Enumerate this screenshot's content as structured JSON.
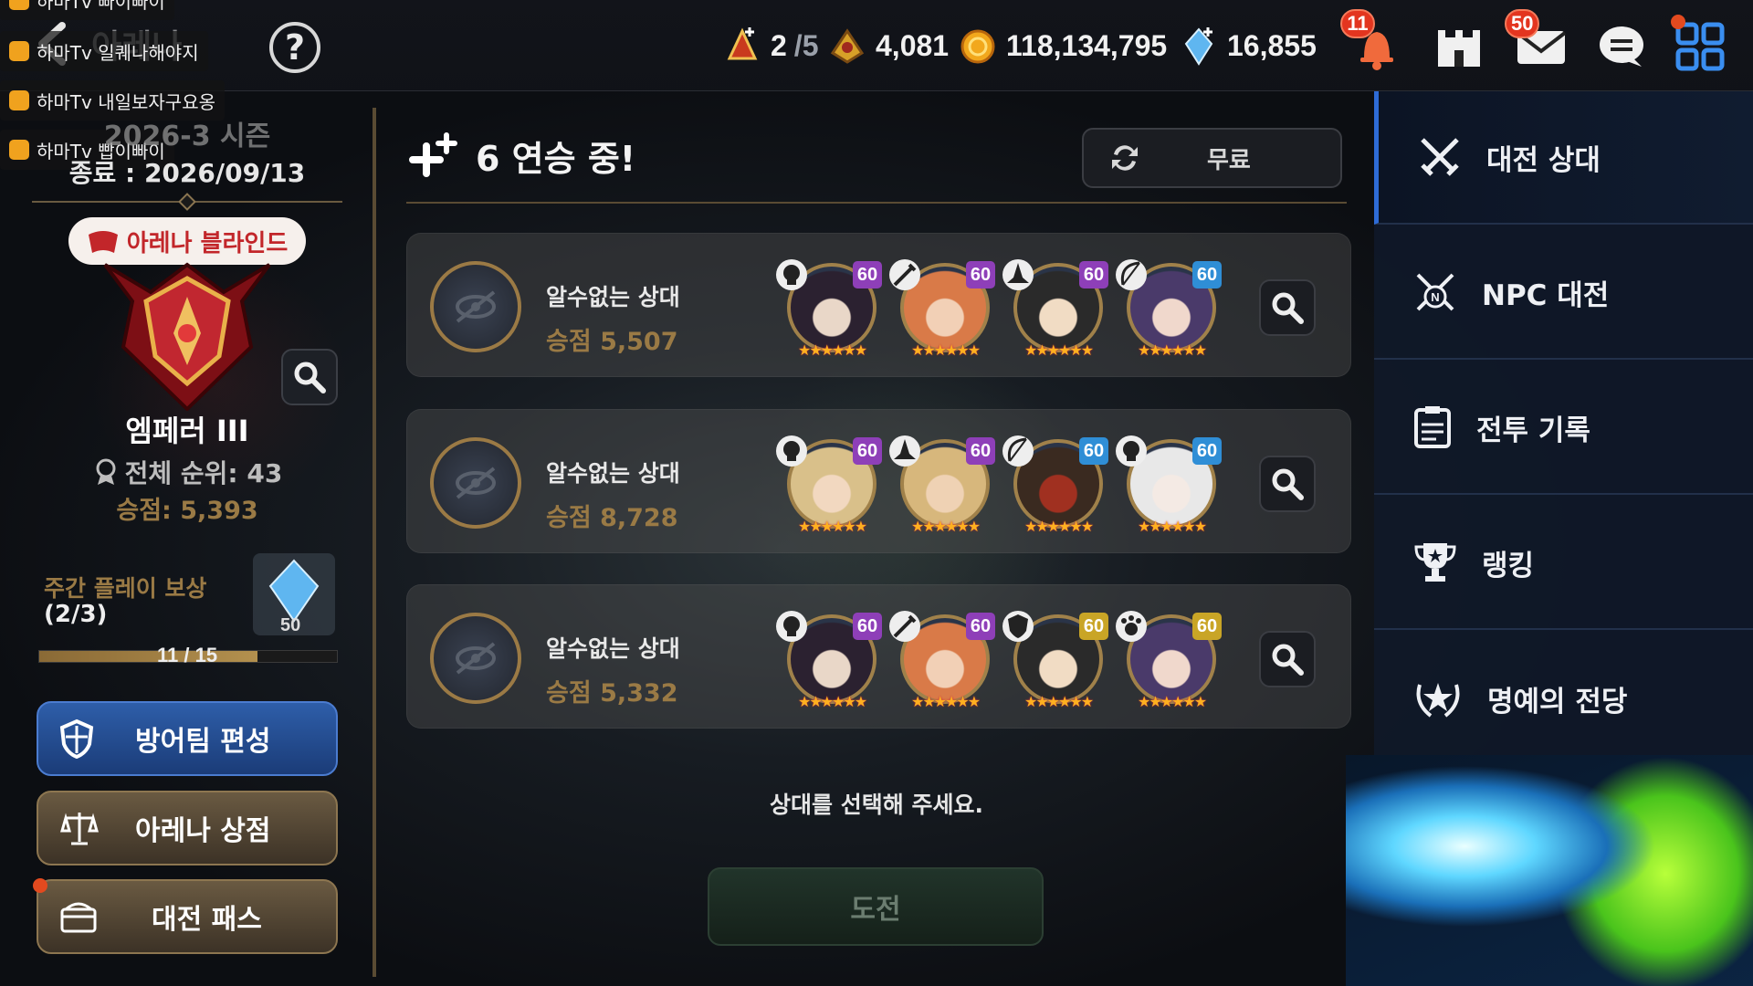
{
  "chat": [
    "하마Tv 빠이빠이",
    "하마Tv 일퀘나해야지",
    "하마Tv 내일보자구요옹",
    "하마Tv 빱이빠이"
  ],
  "header": {
    "title": "아레나",
    "help": "?"
  },
  "resources": {
    "tickets": "2",
    "tickets_max": "/5",
    "points": "4,081",
    "gold": "118,134,795",
    "crystals": "16,855"
  },
  "top_icons": {
    "alarm_badge": "11",
    "mail_badge": "50"
  },
  "season": {
    "name": "2026-3 시즌",
    "end": "종료 : 2026/09/13",
    "rank_label": "아레나 블라인드",
    "tier": "엠페러 III",
    "overall_rank": "전체 순위: 43",
    "points": "승점: 5,393"
  },
  "weekly": {
    "label": "주간 플레이 보상",
    "count": "(2/3)",
    "reward_qty": "50",
    "progress_text": "11 / 15",
    "progress": 0.733
  },
  "left_buttons": {
    "defense": "방어팀 편성",
    "shop": "아레나 상점",
    "pass": "대전 패스"
  },
  "streak": "6 연승 중!",
  "refresh_label": "무료",
  "opponents": [
    {
      "name": "알수없는 상대",
      "score": "승점 5,507",
      "heroes": [
        {
          "lvl": "60",
          "lvl_color": "#8e3fb8",
          "class": "skull"
        },
        {
          "lvl": "60",
          "lvl_color": "#8e3fb8",
          "class": "sword"
        },
        {
          "lvl": "60",
          "lvl_color": "#8e3fb8",
          "class": "hat"
        },
        {
          "lvl": "60",
          "lvl_color": "#2f8ed6",
          "class": "bow"
        }
      ]
    },
    {
      "name": "알수없는 상대",
      "score": "승점 8,728",
      "heroes": [
        {
          "lvl": "60",
          "lvl_color": "#8e3fb8",
          "class": "skull"
        },
        {
          "lvl": "60",
          "lvl_color": "#8e3fb8",
          "class": "hat"
        },
        {
          "lvl": "60",
          "lvl_color": "#2f8ed6",
          "class": "bow"
        },
        {
          "lvl": "60",
          "lvl_color": "#2f8ed6",
          "class": "skull"
        }
      ]
    },
    {
      "name": "알수없는 상대",
      "score": "승점 5,332",
      "heroes": [
        {
          "lvl": "60",
          "lvl_color": "#8e3fb8",
          "class": "skull"
        },
        {
          "lvl": "60",
          "lvl_color": "#8e3fb8",
          "class": "sword"
        },
        {
          "lvl": "60",
          "lvl_color": "#c9a526",
          "class": "shield"
        },
        {
          "lvl": "60",
          "lvl_color": "#c9a526",
          "class": "paw"
        }
      ]
    }
  ],
  "stars": "★★★★★★",
  "prompt": "상대를 선택해 주세요.",
  "challenge": "도전",
  "menu": [
    {
      "label": "대전 상대",
      "icon": "crossed-swords-icon"
    },
    {
      "label": "NPC 대전",
      "icon": "npc-battle-icon"
    },
    {
      "label": "전투 기록",
      "icon": "clipboard-icon"
    },
    {
      "label": "랭킹",
      "icon": "trophy-icon"
    },
    {
      "label": "명예의 전당",
      "icon": "laurel-icon"
    }
  ],
  "colors": {
    "accent_blue": "#2e6bd6",
    "gold": "#9a7a45",
    "badge_red": "#e3351f"
  }
}
